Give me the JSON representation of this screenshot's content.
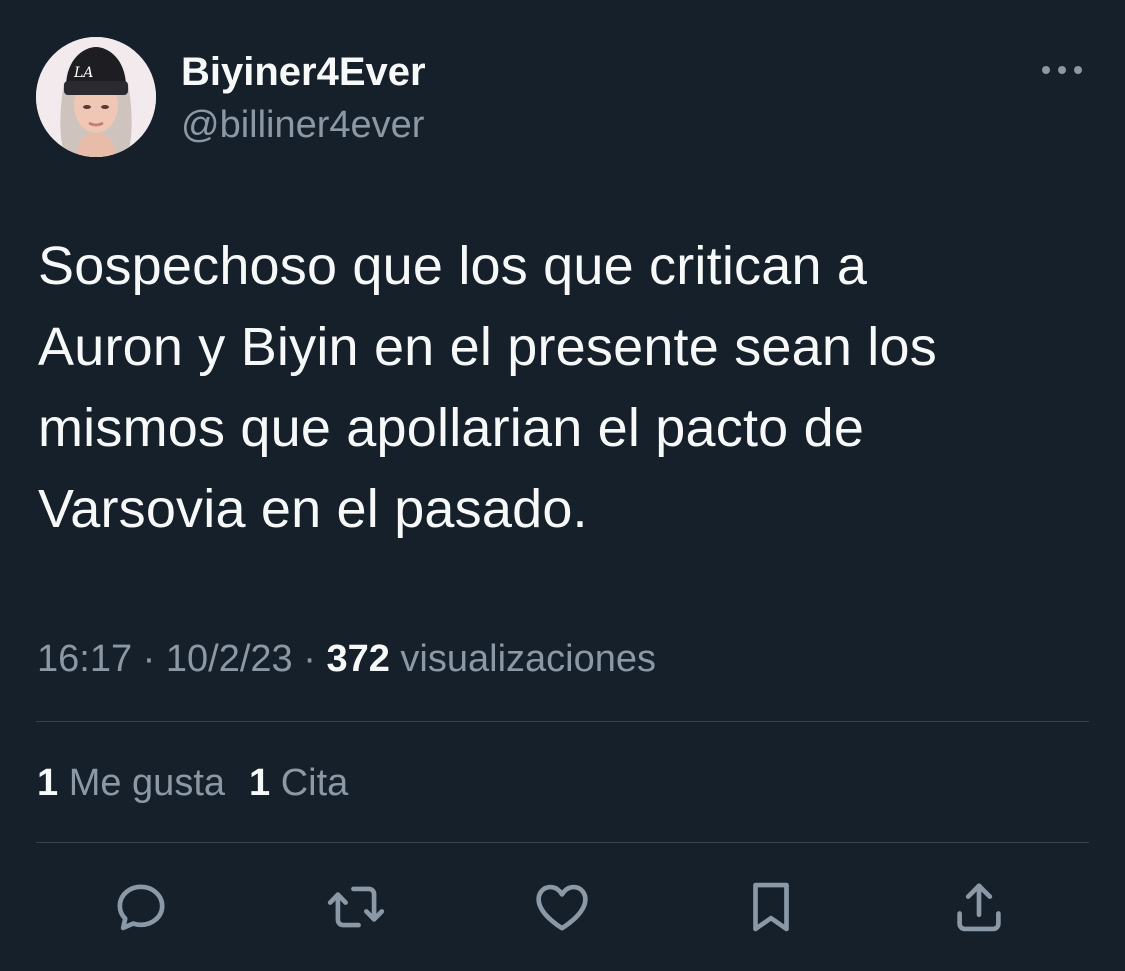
{
  "author": {
    "display_name": "Biyiner4Ever",
    "handle": "@billiner4ever",
    "avatar_hat_text": "LA"
  },
  "tweet": {
    "text": "Sospechoso que los que critican a\nAuron y Biyin en el presente sean los\nmismos que apollarian el pacto de\nVarsovia en el pasado."
  },
  "meta": {
    "time": "16:17",
    "separator": "·",
    "date": "10/2/23",
    "views_count": "372",
    "views_label": "visualizaciones"
  },
  "stats": {
    "likes_count": "1",
    "likes_label": "Me gusta",
    "quotes_count": "1",
    "quotes_label": "Cita"
  },
  "actions": {
    "reply_icon": "reply-icon",
    "retweet_icon": "retweet-icon",
    "like_icon": "heart-icon",
    "bookmark_icon": "bookmark-icon",
    "share_icon": "share-icon"
  },
  "colors": {
    "background": "#15202b",
    "primary_text": "#f7f9f9",
    "secondary_text": "#8b98a5",
    "divider": "#38444d"
  }
}
